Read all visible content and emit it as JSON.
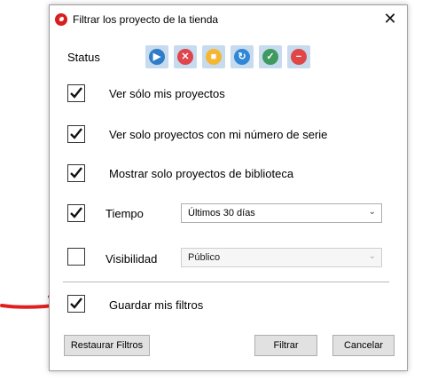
{
  "dialog": {
    "title": "Filtrar los proyecto de la tienda",
    "close_label": "✕"
  },
  "status": {
    "label": "Status",
    "icons": [
      {
        "name": "play-icon",
        "color": "#2f7cc8",
        "glyph": "▶"
      },
      {
        "name": "cancel-icon",
        "color": "#e0444c",
        "glyph": "✕"
      },
      {
        "name": "pause-icon",
        "color": "#f5b731",
        "glyph": "■"
      },
      {
        "name": "sync-icon",
        "color": "#2f87d6",
        "glyph": "↻"
      },
      {
        "name": "check-icon",
        "color": "#3e9a5f",
        "glyph": "✓"
      },
      {
        "name": "stop-icon",
        "color": "#e04646",
        "glyph": "−"
      }
    ],
    "tile_bg": "#c7dbef"
  },
  "options": {
    "only_my_projects": {
      "label": "Ver sólo mis proyectos",
      "checked": true
    },
    "serial_projects": {
      "label": "Ver solo proyectos con mi número de serie",
      "checked": true
    },
    "library_projects": {
      "label": "Mostrar solo proyectos de biblioteca",
      "checked": true
    },
    "save_filters": {
      "label": "Guardar mis filtros",
      "checked": true
    }
  },
  "time": {
    "label": "Tiempo",
    "checked": true,
    "selected": "Últimos 30 días"
  },
  "visibility": {
    "label": "Visibilidad",
    "checked": false,
    "selected": "Público",
    "disabled": true
  },
  "buttons": {
    "reset": "Restaurar Filtros",
    "filter": "Filtrar",
    "cancel": "Cancelar"
  },
  "annotation": {
    "arrow_color": "#e02020"
  }
}
